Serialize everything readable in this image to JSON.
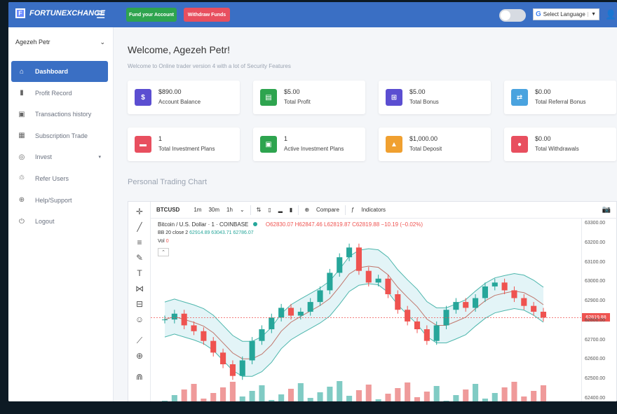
{
  "header": {
    "logo_text": "FORTUNEXCHANGE",
    "fund_button": "Fund your Account",
    "withdraw_button": "Withdraw Funds",
    "language_label": "Select Language"
  },
  "sidebar": {
    "user_name": "Agezeh Petr",
    "items": [
      {
        "label": "Dashboard",
        "icon": "home-icon",
        "glyph": "⌂",
        "active": true
      },
      {
        "label": "Profit Record",
        "icon": "bar-chart-icon",
        "glyph": "▮",
        "active": false
      },
      {
        "label": "Transactions history",
        "icon": "briefcase-icon",
        "glyph": "▣",
        "active": false
      },
      {
        "label": "Subscription Trade",
        "icon": "grid-icon",
        "glyph": "▦",
        "active": false
      },
      {
        "label": "Invest",
        "icon": "coins-icon",
        "glyph": "◎",
        "active": false,
        "caret": true
      },
      {
        "label": "Refer Users",
        "icon": "recycle-icon",
        "glyph": "♲",
        "active": false
      },
      {
        "label": "Help/Support",
        "icon": "lifebuoy-icon",
        "glyph": "⊕",
        "active": false
      },
      {
        "label": "Logout",
        "icon": "power-icon",
        "glyph": "⏻",
        "active": false
      }
    ]
  },
  "main": {
    "welcome": "Welcome, Agezeh Petr!",
    "subtitle": "Welcome to Online trader version 4 with a lot of Security Features",
    "section_title": "Personal Trading Chart"
  },
  "cards": [
    {
      "value": "$890.00",
      "label": "Account Balance",
      "color": "#5b4ed1",
      "glyph": "$"
    },
    {
      "value": "$5.00",
      "label": "Total Profit",
      "color": "#2ea44f",
      "glyph": "▤"
    },
    {
      "value": "$5.00",
      "label": "Total Bonus",
      "color": "#5b4ed1",
      "glyph": "⊞"
    },
    {
      "value": "$0.00",
      "label": "Total Referral Bonus",
      "color": "#4aa3df",
      "glyph": "⇄"
    },
    {
      "value": "1",
      "label": "Total Investment Plans",
      "color": "#e84f5f",
      "glyph": "▬"
    },
    {
      "value": "1",
      "label": "Active Investment Plans",
      "color": "#2ea44f",
      "glyph": "▣"
    },
    {
      "value": "$1,000.00",
      "label": "Total Deposit",
      "color": "#f0a030",
      "glyph": "▲"
    },
    {
      "value": "$0.00",
      "label": "Total Withdrawals",
      "color": "#e84f5f",
      "glyph": "●"
    }
  ],
  "chart": {
    "symbol": "BTCUSD",
    "intervals": [
      "1m",
      "30m",
      "1h"
    ],
    "compare_label": "Compare",
    "indicators_label": "Indicators",
    "title_line": "Bitcoin / U.S. Dollar · 1 · COINBASE",
    "ohlc": "O62830.07 H62847.46 L62819.87 C62819.88 −10.19 (−0.02%)",
    "bb_label": "BB 20 close 2",
    "bb_values": "62914.89  63043.71  62786.07",
    "vol_label": "Vol",
    "vol_value": "0",
    "last_price": "62819.88",
    "y_ticks": [
      "63300.00",
      "63200.00",
      "63100.00",
      "63000.00",
      "62900.00",
      "62800.00",
      "62700.00",
      "62600.00",
      "62500.00",
      "62400.00"
    ]
  },
  "chart_data": {
    "type": "line",
    "title": "Bitcoin / U.S. Dollar · 1 · COINBASE",
    "ylim": [
      62400,
      63300
    ],
    "series": [
      {
        "name": "",
        "values": [
          62810,
          62840,
          62780,
          62750,
          62700,
          62640,
          62580,
          62520,
          62600,
          62700,
          62760,
          62820,
          62870,
          62830,
          62850,
          62900,
          62960,
          63050,
          63130,
          63180,
          63060,
          63000,
          63020,
          62940,
          62860,
          62800,
          62760,
          62700,
          62780,
          62860,
          62900,
          62870,
          62920,
          62980,
          63000,
          62960,
          62920,
          62880,
          62850,
          62820
        ]
      }
    ]
  }
}
